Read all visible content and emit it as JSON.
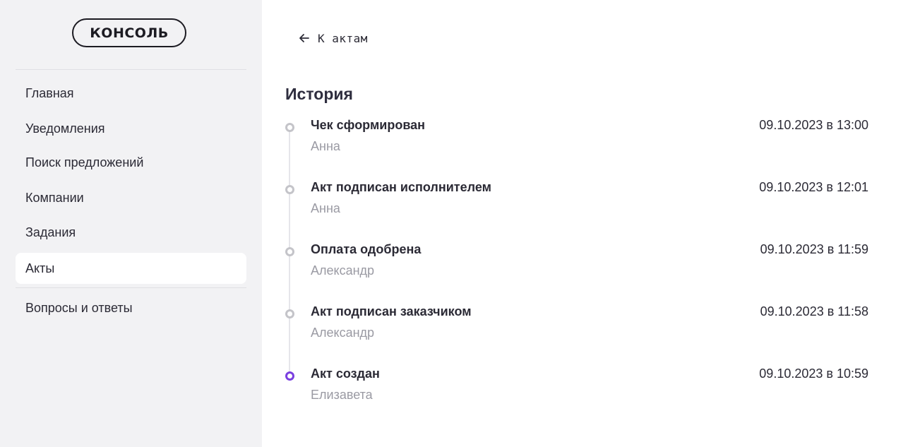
{
  "sidebar": {
    "logo": "КОНСОЛЬ",
    "items": [
      {
        "label": "Главная"
      },
      {
        "label": "Уведомления"
      },
      {
        "label": "Поиск предложений"
      },
      {
        "label": "Компании"
      },
      {
        "label": "Задания"
      },
      {
        "label": "Акты",
        "active": true
      },
      {
        "label": "Вопросы и ответы"
      }
    ]
  },
  "main": {
    "back_link": "К актам",
    "back_icon": "arrow-left-icon",
    "history_title": "История",
    "events": [
      {
        "title": "Чек сформирован",
        "author": "Анна",
        "datetime": "09.10.2023 в 13:00",
        "status": "done"
      },
      {
        "title": "Акт подписан исполнителем",
        "author": "Анна",
        "datetime": "09.10.2023 в 12:01",
        "status": "done"
      },
      {
        "title": "Оплата одобрена",
        "author": "Александр",
        "datetime": "09.10.2023 в 11:59",
        "status": "done"
      },
      {
        "title": "Акт подписан заказчиком",
        "author": "Александр",
        "datetime": "09.10.2023 в 11:58",
        "status": "done"
      },
      {
        "title": "Акт создан",
        "author": "Елизавета",
        "datetime": "09.10.2023 в 10:59",
        "status": "current"
      }
    ]
  },
  "colors": {
    "sidebar_bg": "#f2f2f4",
    "accent": "#7a3fe0",
    "muted_dot": "#c4c4c9",
    "muted_text": "#9a9aa3",
    "text": "#2b2a35"
  }
}
